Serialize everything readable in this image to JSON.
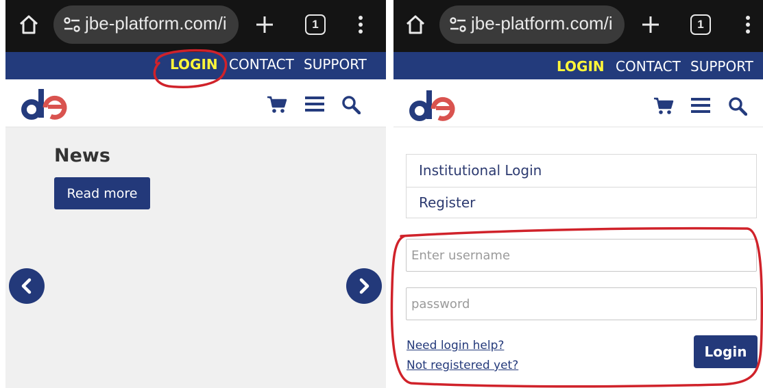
{
  "browser": {
    "url": "jbe-platform.com/i",
    "tab_count": "1"
  },
  "topnav": {
    "login": "LOGIN",
    "contact": "CONTACT",
    "support": "SUPPORT"
  },
  "colors": {
    "nav_bar": "#233b7c",
    "login_highlight": "#fff53a",
    "logo_dark": "#243b7d",
    "logo_red": "#d9534f",
    "annotation": "#d0222a"
  },
  "icons": {
    "header": [
      "cart-icon",
      "menu-icon",
      "search-icon"
    ],
    "browser": [
      "home-icon",
      "site-settings-icon",
      "new-tab-icon",
      "tab-switcher-icon",
      "more-options-icon"
    ]
  },
  "news": {
    "title": "News",
    "read_more": "Read more"
  },
  "login_panel": {
    "institutional_login": "Institutional Login",
    "register": "Register",
    "username_placeholder": "Enter username",
    "password_placeholder": "password",
    "help_link": "Need login help?",
    "not_registered_link": "Not registered yet?",
    "submit": "Login"
  }
}
